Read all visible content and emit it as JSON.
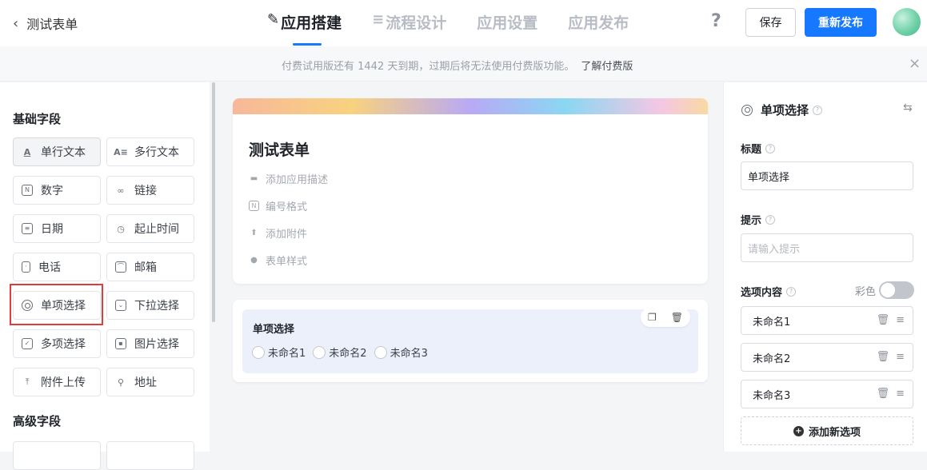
{
  "header": {
    "back_label": "测试表单",
    "tabs": [
      {
        "label": "应用搭建",
        "icon": "edit-icon"
      },
      {
        "label": "流程设计",
        "icon": "menu-icon"
      },
      {
        "label": "应用设置"
      },
      {
        "label": "应用发布"
      }
    ],
    "help": "?",
    "save_label": "保存",
    "publish_label": "重新发布"
  },
  "banner": {
    "text": "付费试用版还有 1442 天到期，过期后将无法使用付费版功能。",
    "link": "了解付费版",
    "close": "×"
  },
  "left_panel": {
    "basic_title": "基础字段",
    "fields": [
      {
        "label": "单行文本",
        "icon": "single-line-text-icon"
      },
      {
        "label": "多行文本",
        "icon": "multi-line-text-icon"
      },
      {
        "label": "数字",
        "icon": "number-icon"
      },
      {
        "label": "链接",
        "icon": "link-icon"
      },
      {
        "label": "日期",
        "icon": "calendar-icon"
      },
      {
        "label": "起止时间",
        "icon": "clock-icon"
      },
      {
        "label": "电话",
        "icon": "phone-icon"
      },
      {
        "label": "邮箱",
        "icon": "mail-icon"
      },
      {
        "label": "单项选择",
        "icon": "radio-icon"
      },
      {
        "label": "下拉选择",
        "icon": "dropdown-icon"
      },
      {
        "label": "多项选择",
        "icon": "checkbox-icon"
      },
      {
        "label": "图片选择",
        "icon": "image-icon"
      },
      {
        "label": "附件上传",
        "icon": "upload-icon"
      },
      {
        "label": "地址",
        "icon": "location-icon"
      }
    ],
    "advanced_title": "高级字段"
  },
  "form": {
    "title": "测试表单",
    "meta": [
      {
        "label": "添加应用描述",
        "icon": "comment-icon"
      },
      {
        "label": "编号格式",
        "icon": "number-format-icon"
      },
      {
        "label": "添加附件",
        "icon": "upload-icon"
      },
      {
        "label": "表单样式",
        "icon": "palette-icon"
      }
    ],
    "widget": {
      "title": "单项选择",
      "options": [
        "未命名1",
        "未命名2",
        "未命名3"
      ]
    }
  },
  "right_panel": {
    "title": "单项选择",
    "title_label": "标题",
    "title_value": "单项选择",
    "hint_label": "提示",
    "hint_placeholder": "请输入提示",
    "options_label": "选项内容",
    "color_label": "彩色",
    "color_enabled": false,
    "options": [
      "未命名1",
      "未命名2",
      "未命名3"
    ],
    "add_option": "添加新选项"
  }
}
